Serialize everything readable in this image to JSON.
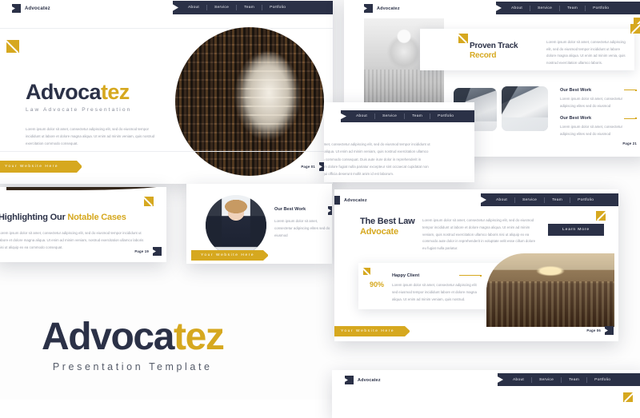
{
  "brand": {
    "name": "Advocatez",
    "accent_yellow": "#d6a81f",
    "accent_navy": "#2b3147",
    "body_grey": "#9a9ea9"
  },
  "nav": {
    "items": [
      "About",
      "Service",
      "Team",
      "Portfolio"
    ]
  },
  "cta": {
    "website_ribbon": "Your Website Here",
    "learn_more": "Learn More"
  },
  "slide1": {
    "logo": "Advocatez",
    "title_dark": "Advoca",
    "title_accent": "tez",
    "subtitle": "Law Advocate Presentation",
    "paragraph": "Lorem ipsum dolor sit amet, consectetur adipiscing elit, sed do eiusmod tempor incididunt ut labore et dolore magna aliqua. Ut enim ad minim veniam, quis nostrud exercitation commodo consequat.",
    "page": "Page 01"
  },
  "slide2": {
    "logo": "Advocatez",
    "card_title_dark": "Proven Track",
    "card_title_accent": "Record",
    "card_paragraph": "Lorem ipsum dolor sit amet, consectetur adipiscing elit, sed do eiusmod tempor incididunt ut labore dolore magna aliqua. Ut enim ad minim venia, quis nostrud exercitation ullamco laboris.",
    "works": [
      {
        "title": "Our Best Work",
        "text": "Lorem ipsum dolor sit amet, consectetur adipiscing elites sed do eiusmod"
      },
      {
        "title": "Our Best Work",
        "text": "Lorem ipsum dolor sit amet, consectetur adipiscing elites sed do eiusmod"
      }
    ],
    "page": "Page 21"
  },
  "slide3": {
    "title_dark": "Highlighting Our",
    "title_accent": "Notable Cases",
    "paragraph": "Lorem ipsum dolor sit amet, consectetur adipiscing elit, sed do eiusmod tempor incididunt ut labore et dolore magna aliqua. Ut enim ad minim veniam, nostrud exercitation ullamco laboris nisi ut aliquip ex ea commodo consequat.",
    "page": "Page 19"
  },
  "slide_overlap": {
    "paragraph": "Lorem ipsum dolor sit amet, consectetur adipiscing elit, sed do eiusmod tempor incididunt ut labore et dolore magna aliqua. Ut enim ad minim veniam, quis nostrud exercitation ullamco laboris nisi aliquip ex ea commodo consequat. Duis aute irure dolor in reprehenderit in voluptate velit esse cillum dolore fugiat nulla pariatur excepteur sint occaecat cupidatat non proident, sunt in culpa qui officia deserunt mollit anim id est laborum."
  },
  "slide_work_panel": {
    "title": "Our Best Work",
    "text": "Lorem ipsum dolor sit amet, consectetur adipiscing elites sed do eiusmod"
  },
  "slide4": {
    "logo": "Advocatez",
    "title_dark": "The Best Law",
    "title_accent": "Advocate",
    "paragraph": "Lorem ipsum dolor sit amet, consectetur adipiscing elit, sed do eiusmod tempor incididunt ut labore et dolore magna aliqua. Ut enim ad minim veniam, quis nostrud exercitation ullamco laboris nisi ut aliquip ex ea commodo aute dolor in reprehenderit in voluptate velit esse cillum dolore eu fugiat nulla pariatur.",
    "stat_value": "90%",
    "stat_title": "Happy Client",
    "stat_text": "Lorem ipsum dolor sit amet, consectetur adipiscing elit sed eiusmod tempor incididunt labore et dolore magna aliqua. Ut enim ad minim veniam, quis nostrud.",
    "page": "Page 06"
  },
  "slide5": {
    "logo": "Advocatez"
  },
  "footer": {
    "title_dark": "Advoca",
    "title_accent": "tez",
    "subtitle": "Presentation Template"
  }
}
